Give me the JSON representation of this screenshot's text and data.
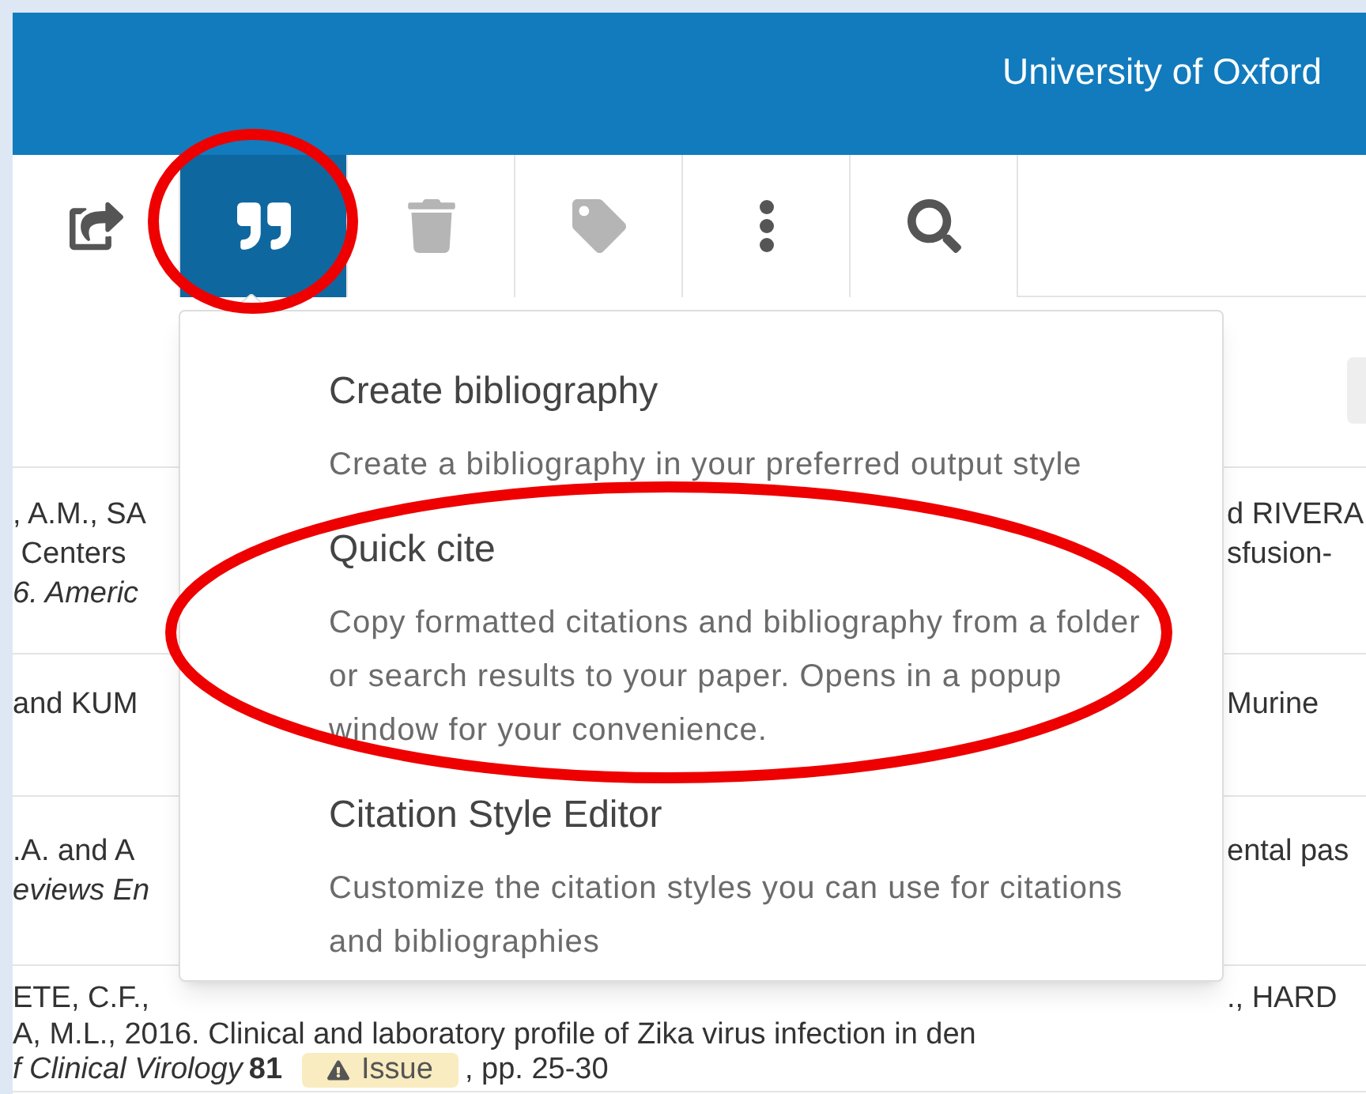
{
  "header": {
    "title": "University of Oxford"
  },
  "toolbar": [
    {
      "kind": "share",
      "selected": false,
      "disabled": false
    },
    {
      "kind": "quote",
      "selected": true,
      "disabled": false
    },
    {
      "kind": "trash",
      "selected": false,
      "disabled": true
    },
    {
      "kind": "tag",
      "selected": false,
      "disabled": true
    },
    {
      "kind": "more",
      "selected": false,
      "disabled": false
    },
    {
      "kind": "search",
      "selected": false,
      "disabled": false
    }
  ],
  "menu": [
    {
      "title": "Create bibliography",
      "description": "Create a bibliography in your preferred output style"
    },
    {
      "title": "Quick cite",
      "description": "Copy formatted citations and bibliography from a folder or search results to your paper. Opens in a popup window for your convenience."
    },
    {
      "title": "Citation Style Editor",
      "description": "Customize the citation styles you can use for citations and bibliographies"
    }
  ],
  "rows": [
    {
      "left": [
        {
          "text": ", A.M., SA",
          "italic": false
        },
        {
          "text": " Centers",
          "italic": false
        },
        {
          "text": "6. Americ",
          "italic": true
        }
      ],
      "right": [
        {
          "text": "d RIVERA",
          "italic": false
        },
        {
          "text": "sfusion-",
          "italic": false
        }
      ]
    },
    {
      "left": [
        {
          "text": "and KUM",
          "italic": false
        }
      ],
      "right": [
        {
          "text": "Murine",
          "italic": false
        }
      ]
    },
    {
      "left": [
        {
          "text": ".A. and A",
          "italic": false
        },
        {
          "text": "eviews En",
          "italic": true
        }
      ],
      "right": [
        {
          "text": "ental pas",
          "italic": false
        }
      ]
    },
    {
      "left": [
        {
          "text": "ETE, C.F.,",
          "italic": false
        }
      ],
      "right": [
        {
          "text": "., HARD",
          "italic": false
        }
      ],
      "line": "A, M.L., 2016. Clinical and laboratory profile of Zika virus infection in den",
      "source": {
        "journal": "f Clinical Virology",
        "volume": "81",
        "badge": "Issue",
        "pages": ", pp. 25-30"
      }
    }
  ]
}
